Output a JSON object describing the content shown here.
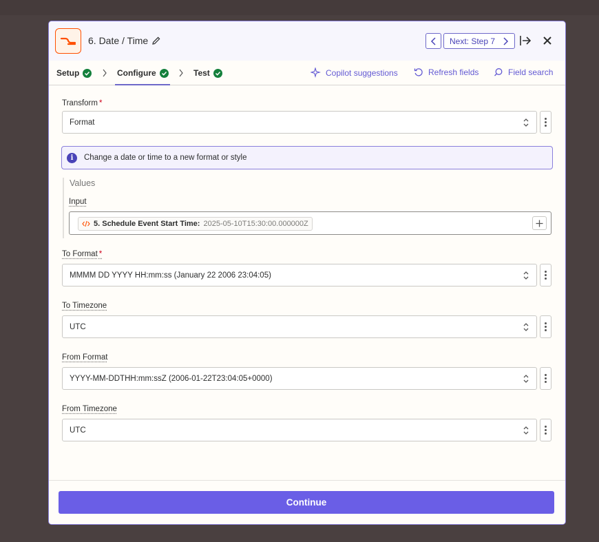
{
  "header": {
    "step_title": "6. Date / Time",
    "next_label": "Next: Step 7"
  },
  "tabs": [
    {
      "label": "Setup"
    },
    {
      "label": "Configure"
    },
    {
      "label": "Test"
    }
  ],
  "tools": {
    "copilot": "Copilot suggestions",
    "refresh": "Refresh fields",
    "search": "Field search"
  },
  "form": {
    "transform": {
      "label": "Transform",
      "required": "*",
      "value": "Format"
    },
    "info_text": "Change a date or time to a new format or style",
    "values_title": "Values",
    "input": {
      "label": "Input",
      "pill_label": "5. Schedule Event Start Time:",
      "pill_value": "2025-05-10T15:30:00.000000Z"
    },
    "to_format": {
      "label": "To Format",
      "required": "*",
      "value": "MMMM DD YYYY HH:mm:ss (January 22 2006 23:04:05)"
    },
    "to_timezone": {
      "label": "To Timezone",
      "value": "UTC"
    },
    "from_format": {
      "label": "From Format",
      "value": "YYYY-MM-DDTHH:mm:ssZ (2006-01-22T23:04:05+0000)"
    },
    "from_timezone": {
      "label": "From Timezone",
      "value": "UTC"
    }
  },
  "footer": {
    "continue_label": "Continue"
  },
  "colors": {
    "accent": "#6a5ee6",
    "brand": "#ff4f00",
    "success": "#14803c"
  },
  "icons": [
    "transform-app-icon",
    "pencil-icon",
    "chevron-left-icon",
    "chevron-right-icon",
    "exit-icon",
    "close-icon",
    "check-icon",
    "sparkle-icon",
    "refresh-icon",
    "search-icon",
    "info-icon",
    "code-icon",
    "plus-icon",
    "updown-icon",
    "kebab-icon"
  ]
}
